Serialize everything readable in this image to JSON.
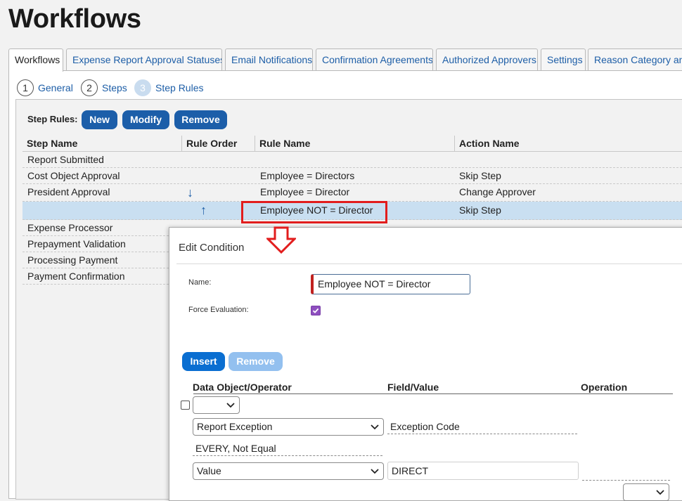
{
  "page": {
    "title": "Workflows"
  },
  "tabs": [
    "Workflows",
    "Expense Report Approval Statuses",
    "Email Notifications",
    "Confirmation Agreements",
    "Authorized Approvers",
    "Settings",
    "Reason Category and"
  ],
  "wizard": [
    {
      "num": "1",
      "label": "General"
    },
    {
      "num": "2",
      "label": "Steps"
    },
    {
      "num": "3",
      "label": "Step Rules"
    }
  ],
  "step_rules": {
    "label": "Step Rules:",
    "buttons": {
      "new": "New",
      "modify": "Modify",
      "remove": "Remove"
    },
    "columns": [
      "Step Name",
      "Rule Order",
      "Rule Name",
      "Action Name"
    ],
    "rows": [
      {
        "step": "Report Submitted",
        "rule": "",
        "action": ""
      },
      {
        "step": "Cost Object Approval",
        "rule": "Employee = Directors",
        "action": "Skip Step"
      },
      {
        "step": "President Approval",
        "rule": "Employee = Director",
        "action": "Change Approver"
      },
      {
        "step": "",
        "rule": "Employee NOT = Director",
        "action": "Skip Step"
      },
      {
        "step": "Expense Processor",
        "rule": "",
        "action": ""
      },
      {
        "step": "Prepayment Validation",
        "rule": "",
        "action": ""
      },
      {
        "step": "Processing Payment",
        "rule": "",
        "action": ""
      },
      {
        "step": "Payment Confirmation",
        "rule": "",
        "action": ""
      }
    ]
  },
  "dialog": {
    "title": "Edit Condition",
    "name_label": "Name:",
    "name_value": "Employee NOT = Director",
    "force_label": "Force Evaluation:",
    "force_checked": true,
    "buttons": {
      "insert": "Insert",
      "remove": "Remove"
    },
    "columns": [
      "Data Object/Operator",
      "Field/Value",
      "Operation"
    ],
    "rows": {
      "operator_select": "",
      "data_object": "Report Exception",
      "field": "Exception Code",
      "operator_text": "EVERY, Not Equal",
      "value_type": "Value",
      "value": "DIRECT"
    }
  },
  "colors": {
    "primary_button": "#1c5ea9",
    "dialog_primary": "#0a6ed1",
    "disabled_button": "#93c0ef",
    "selected_row": "#c9dff1",
    "highlight": "#e21d1d",
    "checkbox": "#8e4fbf"
  }
}
